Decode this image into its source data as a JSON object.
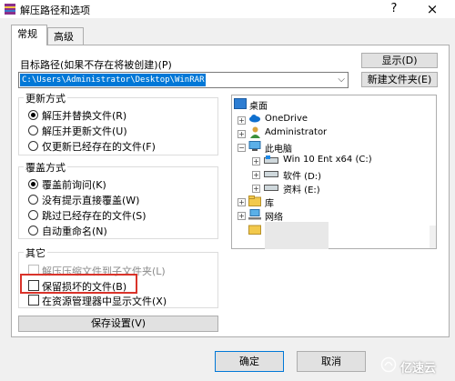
{
  "window": {
    "title": "解压路径和选项",
    "help_glyph": "?",
    "close_glyph": "×"
  },
  "tabs": [
    {
      "label": "常规"
    },
    {
      "label": "高级"
    }
  ],
  "target_path": {
    "label": "目标路径(如果不存在将被创建)(P)",
    "value": "C:\\Users\\Administrator\\Desktop\\WinRAR"
  },
  "buttons": {
    "show": "显示(D)",
    "new_folder": "新建文件夹(E)",
    "save_settings": "保存设置(V)",
    "ok": "确定",
    "cancel": "取消"
  },
  "update_mode": {
    "title": "更新方式",
    "options": [
      "解压并替换文件(R)",
      "解压并更新文件(U)",
      "仅更新已经存在的文件(F)"
    ],
    "selected": 0
  },
  "overwrite_mode": {
    "title": "覆盖方式",
    "options": [
      "覆盖前询问(K)",
      "没有提示直接覆盖(W)",
      "跳过已经存在的文件(S)",
      "自动重命名(N)"
    ],
    "selected": 0
  },
  "misc": {
    "title": "其它",
    "options": [
      {
        "label": "解压压缩文件到子文件夹(L)",
        "checked": false,
        "disabled": true
      },
      {
        "label": "保留损坏的文件(B)",
        "checked": false,
        "disabled": false
      },
      {
        "label": "在资源管理器中显示文件(X)",
        "checked": false,
        "disabled": false
      }
    ]
  },
  "tree": {
    "root": "桌面",
    "items": [
      {
        "label": "OneDrive",
        "icon": "cloud-icon"
      },
      {
        "label": "Administrator",
        "icon": "user-icon"
      },
      {
        "label": "此电脑",
        "icon": "computer-icon"
      },
      {
        "label": "Win 10 Ent x64 (C:)",
        "icon": "drive-icon"
      },
      {
        "label": "软件 (D:)",
        "icon": "drive-icon"
      },
      {
        "label": "资料 (E:)",
        "icon": "drive-icon"
      },
      {
        "label": "库",
        "icon": "library-icon"
      },
      {
        "label": "网络",
        "icon": "network-icon"
      }
    ]
  },
  "watermark": {
    "text": "亿速云"
  },
  "colors": {
    "highlight_box": "#d9332a",
    "path_selection": "#0078d7"
  }
}
